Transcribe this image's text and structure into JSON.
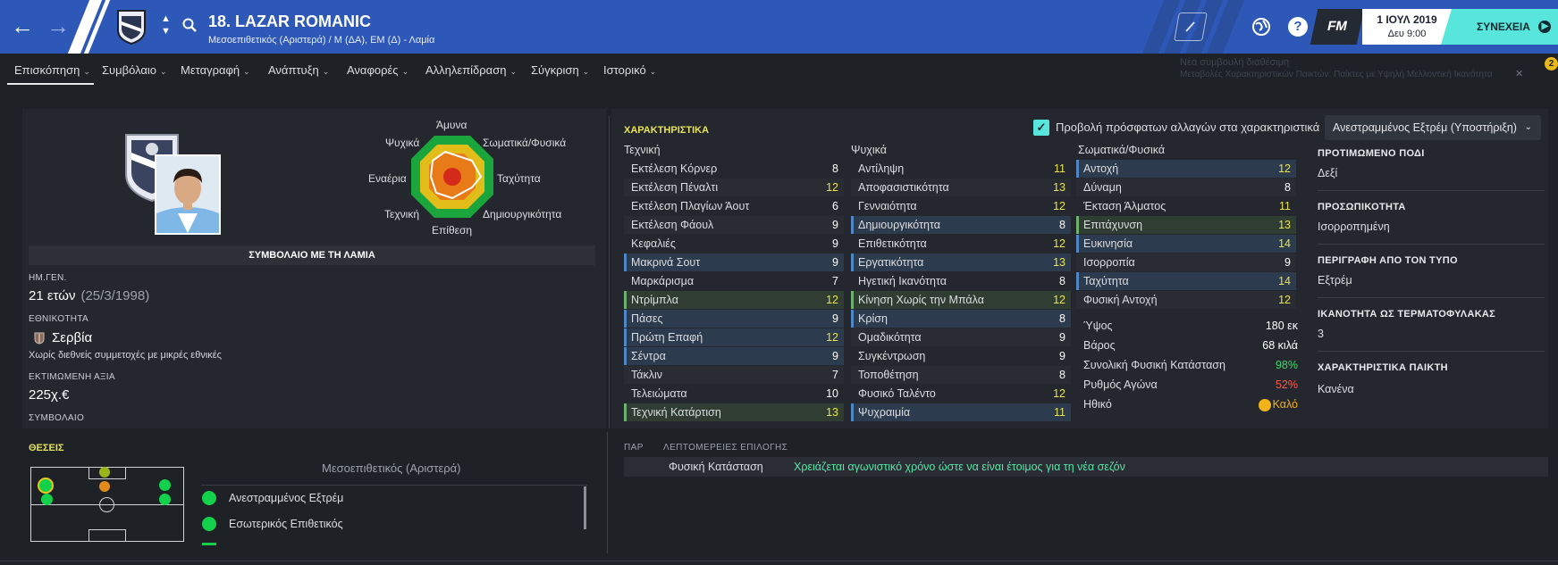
{
  "header": {
    "title": "18. LAZAR ROMANIC",
    "subtitle": "Μεσοεπιθετικός (Αριστερά) / Μ (ΔΑ), ΕΜ (Δ) - Λαμία",
    "date": "1 ΙΟΥΛ 2019",
    "time": "Δευ 9:00",
    "fm_label": "FM",
    "continue_label": "ΣΥΝΕΧΕΙΑ"
  },
  "menu": [
    {
      "label": "Επισκόπηση"
    },
    {
      "label": "Συμβόλαιο"
    },
    {
      "label": "Μεταγραφή"
    },
    {
      "label": "Ανάπτυξη"
    },
    {
      "label": "Αναφορές"
    },
    {
      "label": "Αλληλεπίδραση"
    },
    {
      "label": "Σύγκριση"
    },
    {
      "label": "Ιστορικό"
    }
  ],
  "notification": {
    "line1": "Νέα συμβουλή διαθέσιμη",
    "line2": "Μεταβολές Χαρακτηριστικών Παικτών: Παίκτες με Υψηλή Μελλοντική Ικανότητα",
    "count": "2"
  },
  "radar": {
    "labels": {
      "top": "Άμυνα",
      "top_left": "Ψυχικά",
      "top_right": "Σωματικά/Φυσικά",
      "left": "Εναέρια",
      "right": "Ταχύτητα",
      "bottom_left": "Τεχνική",
      "bottom_right": "Δημιουργικότητα",
      "bottom": "Επίθεση"
    },
    "colors": {
      "ring_outer": "#1aa63c",
      "ring_mid": "#e2bd1a",
      "ring_inner": "#e97a18",
      "center": "#d42a1a"
    }
  },
  "profile": {
    "contract_header": "ΣΥΜΒΟΛΑΙΟ ΜΕ ΤΗ ΛΑΜΙΑ",
    "dob_label": "ΗΜ.ΓΕΝ.",
    "age": "21 ετών",
    "dob": "(25/3/1998)",
    "nationality_label": "ΕΘΝΙΚΟΤΗΤΑ",
    "nationality": "Σερβία",
    "caps": "Χωρίς διεθνείς συμμετοχές με μικρές εθνικές",
    "value_label": "ΕΚΤΙΜΩΜΕΝΗ ΑΞΙΑ",
    "value": "225χ.€",
    "contract_label": "ΣΥΜΒΟΛΑΙΟ"
  },
  "attributes": {
    "title": "ΧΑΡΑΚΤΗΡΙΣΤΙΚΑ",
    "toggle_label": "Προβολή πρόσφατων αλλαγών στα χαρακτηριστικά",
    "role_dropdown": "Ανεστραμμένος Εξτρέμ (Υποστήριξη)",
    "technical_header": "Τεχνική",
    "mental_header": "Ψυχικά",
    "physical_header": "Σωματικά/Φυσικά",
    "technical": [
      {
        "name": "Εκτέλεση Κόρνερ",
        "value": "8",
        "hl": ""
      },
      {
        "name": "Εκτέλεση Πέναλτι",
        "value": "12",
        "hl": ""
      },
      {
        "name": "Εκτέλεση Πλαγίων Άουτ",
        "value": "6",
        "hl": ""
      },
      {
        "name": "Εκτέλεση Φάουλ",
        "value": "9",
        "hl": ""
      },
      {
        "name": "Κεφαλιές",
        "value": "9",
        "hl": ""
      },
      {
        "name": "Μακρινά Σουτ",
        "value": "9",
        "hl": "blue"
      },
      {
        "name": "Μαρκάρισμα",
        "value": "7",
        "hl": ""
      },
      {
        "name": "Ντρίμπλα",
        "value": "12",
        "hl": "green"
      },
      {
        "name": "Πάσες",
        "value": "9",
        "hl": "blue"
      },
      {
        "name": "Πρώτη Επαφή",
        "value": "12",
        "hl": "blue"
      },
      {
        "name": "Σέντρα",
        "value": "9",
        "hl": "blue"
      },
      {
        "name": "Τάκλιν",
        "value": "7",
        "hl": ""
      },
      {
        "name": "Τελειώματα",
        "value": "10",
        "hl": ""
      },
      {
        "name": "Τεχνική Κατάρτιση",
        "value": "13",
        "hl": "green"
      }
    ],
    "mental": [
      {
        "name": "Αντίληψη",
        "value": "11",
        "hl": ""
      },
      {
        "name": "Αποφασιστικότητα",
        "value": "13",
        "hl": ""
      },
      {
        "name": "Γενναιότητα",
        "value": "12",
        "hl": ""
      },
      {
        "name": "Δημιουργικότητα",
        "value": "8",
        "hl": "blue"
      },
      {
        "name": "Επιθετικότητα",
        "value": "12",
        "hl": ""
      },
      {
        "name": "Εργατικότητα",
        "value": "13",
        "hl": "blue"
      },
      {
        "name": "Ηγετική Ικανότητα",
        "value": "8",
        "hl": ""
      },
      {
        "name": "Κίνηση Χωρίς την Μπάλα",
        "value": "12",
        "hl": "green"
      },
      {
        "name": "Κρίση",
        "value": "8",
        "hl": "blue"
      },
      {
        "name": "Ομαδικότητα",
        "value": "9",
        "hl": ""
      },
      {
        "name": "Συγκέντρωση",
        "value": "9",
        "hl": ""
      },
      {
        "name": "Τοποθέτηση",
        "value": "8",
        "hl": ""
      },
      {
        "name": "Φυσικό Ταλέντο",
        "value": "12",
        "hl": ""
      },
      {
        "name": "Ψυχραιμία",
        "value": "11",
        "hl": "blue"
      }
    ],
    "physical": [
      {
        "name": "Αντοχή",
        "value": "12",
        "hl": "blue"
      },
      {
        "name": "Δύναμη",
        "value": "8",
        "hl": ""
      },
      {
        "name": "Έκταση Άλματος",
        "value": "11",
        "hl": ""
      },
      {
        "name": "Επιτάχυνση",
        "value": "13",
        "hl": "green"
      },
      {
        "name": "Ευκινησία",
        "value": "14",
        "hl": "blue"
      },
      {
        "name": "Ισορροπία",
        "value": "9",
        "hl": ""
      },
      {
        "name": "Ταχύτητα",
        "value": "14",
        "hl": "blue"
      },
      {
        "name": "Φυσική Αντοχή",
        "value": "12",
        "hl": ""
      }
    ],
    "colors": {
      "white_value": "#ffffff",
      "yellow_value": "#e8e455",
      "highlight_blue": "#2d3b4e",
      "highlight_green": "#2f3d33"
    }
  },
  "physical_info": {
    "height_label": "Ύψος",
    "height": "180 εκ",
    "weight_label": "Βάρος",
    "weight": "68 κιλά",
    "condition_label": "Συνολική Φυσική Κατάσταση",
    "condition": "98%",
    "sharpness_label": "Ρυθμός Αγώνα",
    "sharpness": "52%",
    "morale_label": "Ηθικό",
    "morale": "Καλό",
    "colors": {
      "condition": "#3fd66b",
      "sharpness": "#ff5a4a",
      "morale": "#f2b21a"
    }
  },
  "info": [
    {
      "label": "ΠΡΟΤΙΜΩΜΕΝΟ ΠΟΔΙ",
      "value": "Δεξί"
    },
    {
      "label": "ΠΡΟΣΩΠΙΚΟΤΗΤΑ",
      "value": "Ισορροπημένη"
    },
    {
      "label": "ΠΕΡΙΓΡΑΦΗ ΑΠΟ ΤΟΝ ΤΥΠΟ",
      "value": "Εξτρέμ"
    },
    {
      "label": "ΙΚΑΝΟΤΗΤΑ ΩΣ ΤΕΡΜΑΤΟΦΥΛΑΚΑΣ",
      "value": "3"
    },
    {
      "label": "ΧΑΡΑΚΤΗΡΙΣΤΙΚΑ ΠΑΙΚΤΗ",
      "value": "Κανένα"
    }
  ],
  "positions": {
    "title": "ΘΕΣΕΙΣ",
    "main": "Μεσοεπιθετικός (Αριστερά)",
    "roles": [
      "Ανεστραμμένος Εξτρέμ",
      "Εσωτερικός Επιθετικός"
    ]
  },
  "report": {
    "col1": "ΠΑΡ",
    "col2": "ΛΕΠΤΟΜΕΡΕΙΕΣ ΕΠΙΛΟΓΗΣ",
    "row_label": "Φυσική Κατάσταση",
    "row_value": "Χρειάζεται αγωνιστικό χρόνο ώστε να είναι έτοιμος για τη νέα σεζόν"
  }
}
